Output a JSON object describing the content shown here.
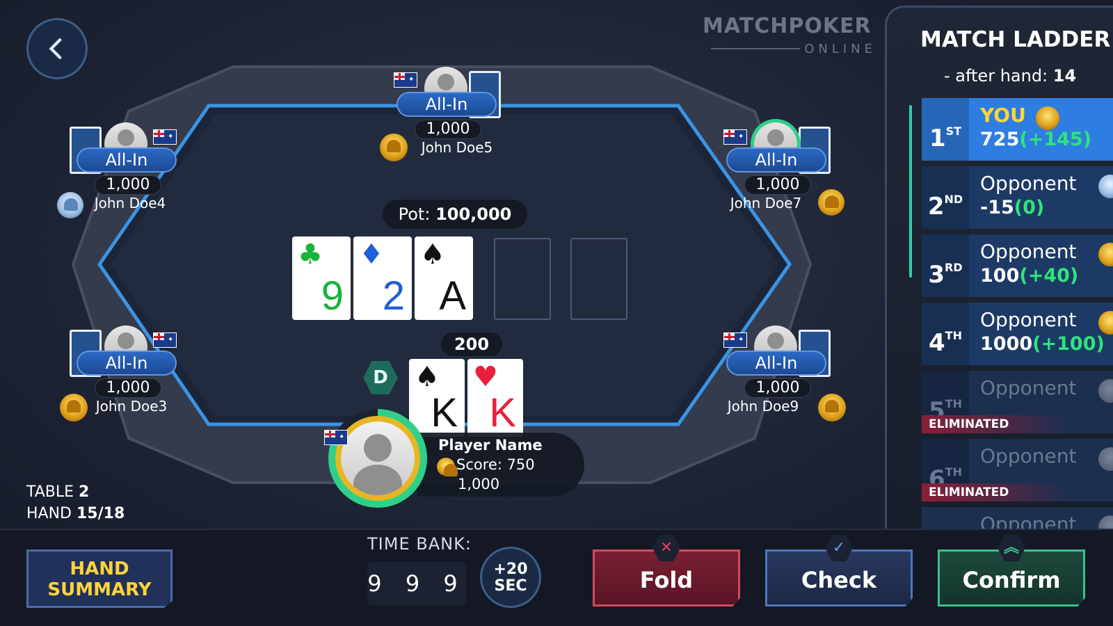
{
  "logo": {
    "main": "MATCHPOKER",
    "sub": "ONLINE"
  },
  "pot": {
    "label": "Pot:",
    "value": "100,000"
  },
  "board": [
    {
      "rank": "9",
      "suit": "♣",
      "color": "#17b33a"
    },
    {
      "rank": "2",
      "suit": "♦",
      "color": "#1f5fd8"
    },
    {
      "rank": "A",
      "suit": "♠",
      "color": "#111111"
    }
  ],
  "seats": {
    "top": {
      "status": "All-In",
      "chips": "1,000",
      "name": "John Doe5"
    },
    "left_top": {
      "status": "All-In",
      "chips": "1,000",
      "name": "John Doe4"
    },
    "right_top": {
      "status": "All-In",
      "chips": "1,000",
      "name": "John Doe7"
    },
    "left_bottom": {
      "status": "All-In",
      "chips": "1,000",
      "name": "John Doe3"
    },
    "right_bottom": {
      "status": "All-In",
      "chips": "1,000",
      "name": "John Doe9"
    }
  },
  "player": {
    "bet": "200",
    "dealer": "D",
    "cards": [
      {
        "rank": "K",
        "suit": "♠",
        "color": "#111111"
      },
      {
        "rank": "K",
        "suit": "♥",
        "color": "#e8203a"
      }
    ],
    "name": "Player Name",
    "score": "Score: 750",
    "stack": "1,000"
  },
  "table_info": {
    "table_label": "TABLE",
    "table_num": "2",
    "hand_label": "HAND",
    "hand_num": "15/18"
  },
  "ladder": {
    "title": "MATCH LADDER",
    "sub_label": "- after hand:",
    "sub_hand": "14",
    "rows": [
      {
        "pos": "1",
        "suffix": "ST",
        "name": "YOU",
        "score": "725",
        "delta": "(+145)",
        "badge": "gold"
      },
      {
        "pos": "2",
        "suffix": "ND",
        "name": "Opponent",
        "score": "-15",
        "delta": "(0)",
        "badge": "silver"
      },
      {
        "pos": "3",
        "suffix": "RD",
        "name": "Opponent",
        "score": "100",
        "delta": "(+40)",
        "badge": "gold"
      },
      {
        "pos": "4",
        "suffix": "TH",
        "name": "Opponent",
        "score": "1000",
        "delta": "(+100)",
        "badge": "gold"
      },
      {
        "pos": "5",
        "suffix": "TH",
        "name": "Opponent",
        "status": "ELIMINATED",
        "badge": "grey"
      },
      {
        "pos": "6",
        "suffix": "TH",
        "name": "Opponent",
        "status": "ELIMINATED",
        "badge": "grey"
      },
      {
        "name": "Opponent"
      }
    ]
  },
  "bottom": {
    "hand_summary": "HAND SUMMARY",
    "time_bank_label": "TIME BANK:",
    "time_bank_digits": "9 9 9",
    "add_time": "+20 SEC",
    "fold": "Fold",
    "check": "Check",
    "confirm": "Confirm"
  }
}
